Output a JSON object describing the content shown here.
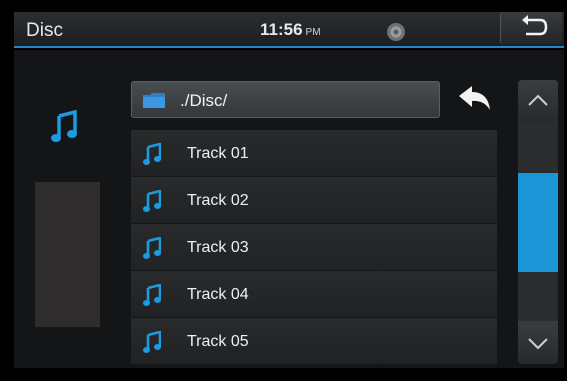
{
  "header": {
    "title": "Disc",
    "time": "11:56",
    "ampm": "PM"
  },
  "icons": {
    "back": "return-arrow-icon",
    "disc": "disc-icon",
    "music": "music-note-icon",
    "folder": "folder-icon",
    "parent": "parent-folder-arrow-icon",
    "scroll_up": "chevron-up-icon",
    "scroll_down": "chevron-down-icon"
  },
  "colors": {
    "accent": "#1b95d6",
    "note": "#1e9be0"
  },
  "browser": {
    "path": "./Disc/",
    "tracks": [
      {
        "label": "Track 01"
      },
      {
        "label": "Track 02"
      },
      {
        "label": "Track 03"
      },
      {
        "label": "Track 04"
      },
      {
        "label": "Track 05"
      }
    ]
  },
  "scrollbar": {
    "position_fraction": 0.5,
    "visible_fraction": 0.5
  }
}
